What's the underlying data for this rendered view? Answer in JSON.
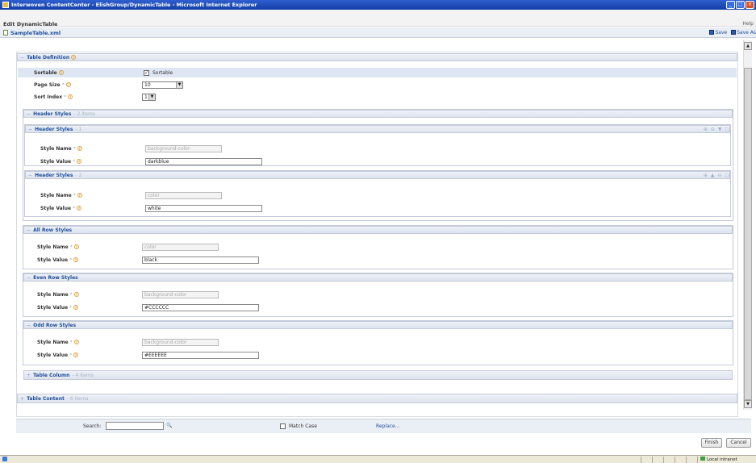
{
  "window": {
    "title": "Interwoven ContentCenter - ElishGroup/DynamicTable - Microsoft Internet Explorer"
  },
  "header": {
    "page_title": "Edit DynamicTable",
    "help": "Help",
    "file_name": "SampleTable.xml",
    "save": "Save",
    "save_as": "Save As"
  },
  "table_definition": {
    "title": "Table Definition",
    "sortable": {
      "label": "Sortable",
      "checkbox_label": "Sortable",
      "checked": true
    },
    "page_size": {
      "label": "Page Size",
      "value": "10"
    },
    "sort_index": {
      "label": "Sort Index",
      "value": "1"
    }
  },
  "header_styles": {
    "title": "Header Styles",
    "count": "2 items",
    "items": [
      {
        "title": "Header Styles",
        "index": "1",
        "name_label": "Style Name",
        "name": "background-color",
        "value_label": "Style Value",
        "value": "darkblue"
      },
      {
        "title": "Header Styles",
        "index": "2",
        "name_label": "Style Name",
        "name": "color",
        "value_label": "Style Value",
        "value": "white"
      }
    ]
  },
  "all_row_styles": {
    "title": "All Row Styles",
    "name_label": "Style Name",
    "name": "color",
    "value_label": "Style Value",
    "value": "black"
  },
  "even_row_styles": {
    "title": "Even Row Styles",
    "name_label": "Style Name",
    "name": "background-color",
    "value_label": "Style Value",
    "value": "#CCCCCC"
  },
  "odd_row_styles": {
    "title": "Odd Row Styles",
    "name_label": "Style Name",
    "name": "background-color",
    "value_label": "Style Value",
    "value": "#EEEEEE"
  },
  "table_column": {
    "title": "Table Column",
    "count": "4 items"
  },
  "table_content": {
    "title": "Table Content",
    "count": "6 items"
  },
  "search": {
    "label": "Search:",
    "value": "",
    "match_case": "Match Case",
    "replace": "Replace..."
  },
  "buttons": {
    "finish": "Finish",
    "cancel": "Cancel"
  },
  "status": {
    "zone": "Local intranet"
  },
  "icons": {
    "toggle_collapse": "−",
    "toggle_expand": "+",
    "help": "?",
    "search": "🔍"
  },
  "colors": {
    "accent": "#1d4f9a",
    "section_bg": "#dde3ee",
    "titlebar": "#123fa6"
  }
}
